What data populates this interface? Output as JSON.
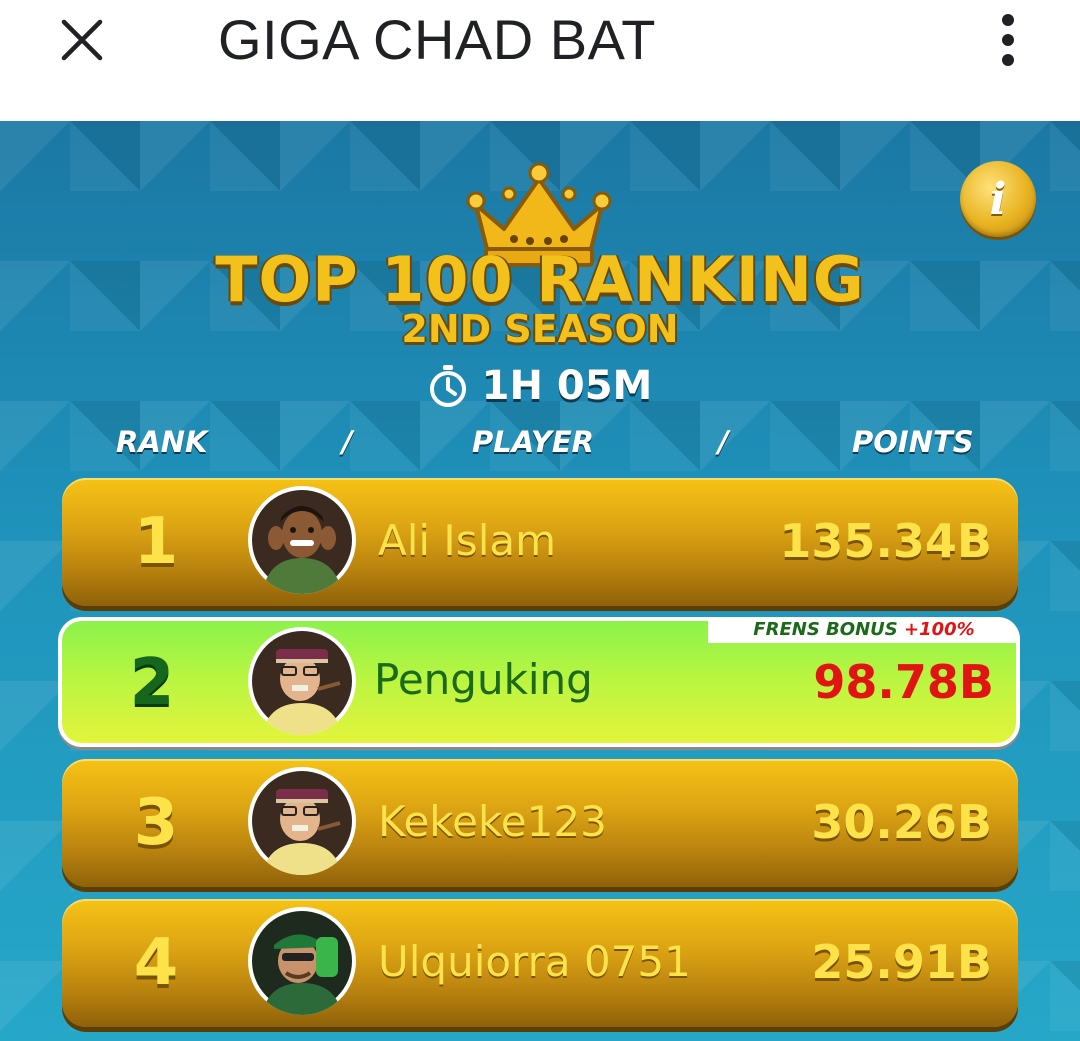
{
  "appbar": {
    "title": "GIGA CHAD BAT",
    "close_icon": "close-icon",
    "menu_icon": "more-vert-icon"
  },
  "ranking": {
    "title": "TOP 100 RANKING",
    "subtitle": "2ND SEASON",
    "timer": "1H 05M",
    "info_label": "i",
    "headers": {
      "rank": "RANK",
      "sep1": "/",
      "player": "PLAYER",
      "sep2": "/",
      "points": "POINTS"
    },
    "rows": [
      {
        "rank": "1",
        "player": "Ali Islam",
        "points": "135.34B"
      },
      {
        "rank": "2",
        "player": "Penguking",
        "points": "98.78B",
        "bonus_label": "FRENS BONUS ",
        "bonus_value": "+100%"
      },
      {
        "rank": "3",
        "player": "Kekeke123",
        "points": "30.26B"
      },
      {
        "rank": "4",
        "player": "Ulquiorra 0751",
        "points": "25.91B"
      }
    ]
  },
  "colors": {
    "accent_gold": "#f3c11c",
    "highlight_green": "#b7f541",
    "points_red": "#e11414",
    "background_blue": "#1f93bb"
  }
}
